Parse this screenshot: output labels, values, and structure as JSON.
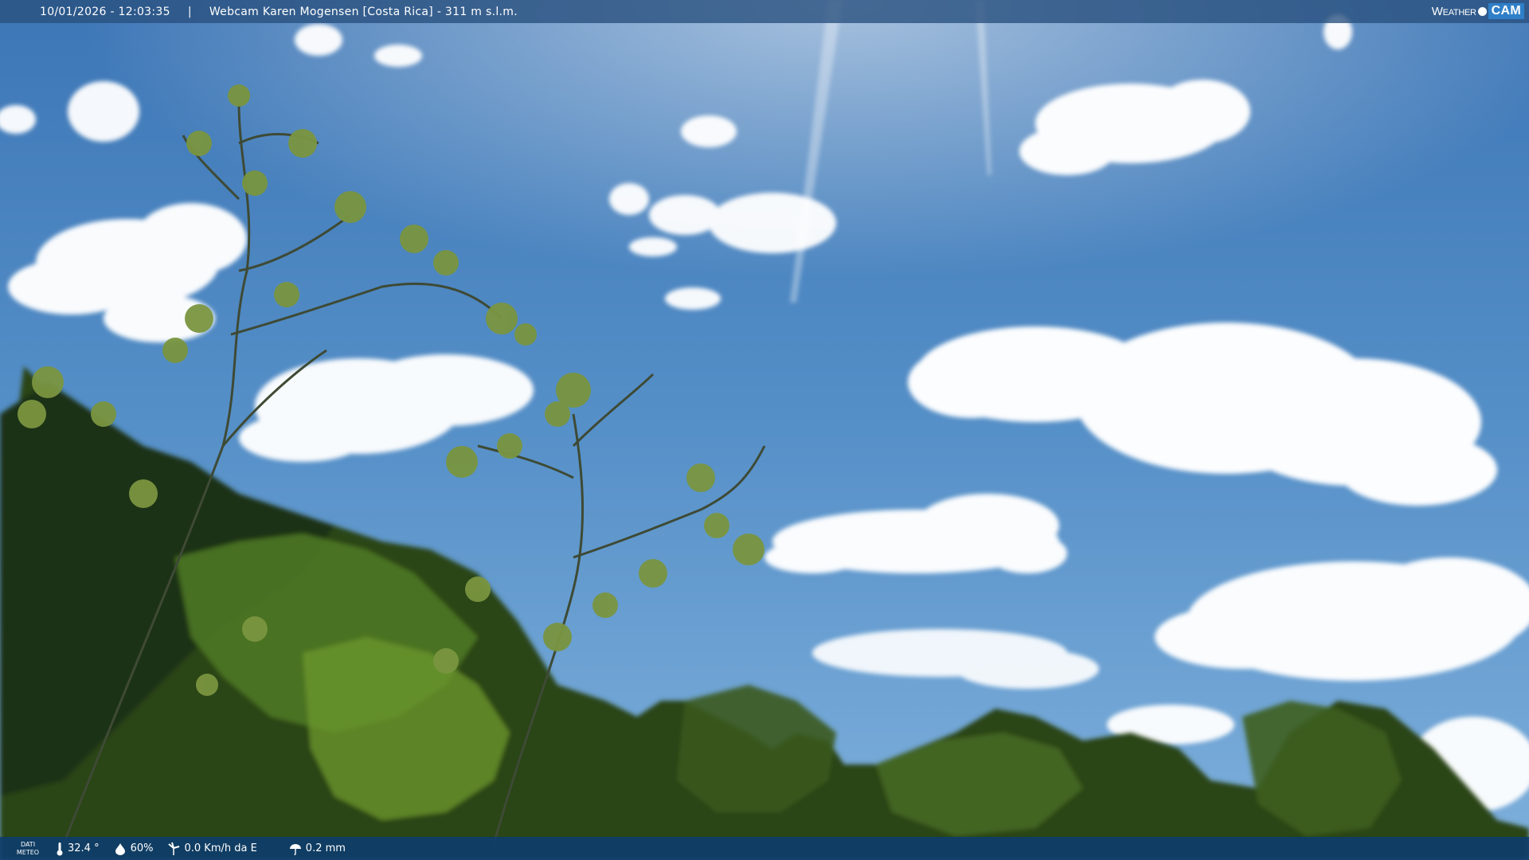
{
  "header": {
    "datetime": "10/01/2026 - 12:03:35",
    "separator": "|",
    "caption": "Webcam Karen Mogensen [Costa Rica] - 311 m s.l.m."
  },
  "brand": {
    "word1": "Weather",
    "word2": "CAM"
  },
  "footer": {
    "label_line1": "DATI",
    "label_line2": "METEO",
    "temperature": "32.4 °",
    "humidity": "60%",
    "wind": "0.0 Km/h da E",
    "rain": "0.2 mm"
  },
  "colors": {
    "sky_top": "#3f78b8",
    "sky_bottom": "#6fa3d4",
    "cloud": "#ffffff",
    "foliage_dark": "#1f3414",
    "foliage_light": "#6f8f2e",
    "topbar": "#28507d",
    "bottombar": "#0c3c6e"
  },
  "icons": {
    "temperature": "thermometer-icon",
    "humidity": "droplet-icon",
    "wind": "wind-turbine-icon",
    "rain": "umbrella-icon"
  }
}
